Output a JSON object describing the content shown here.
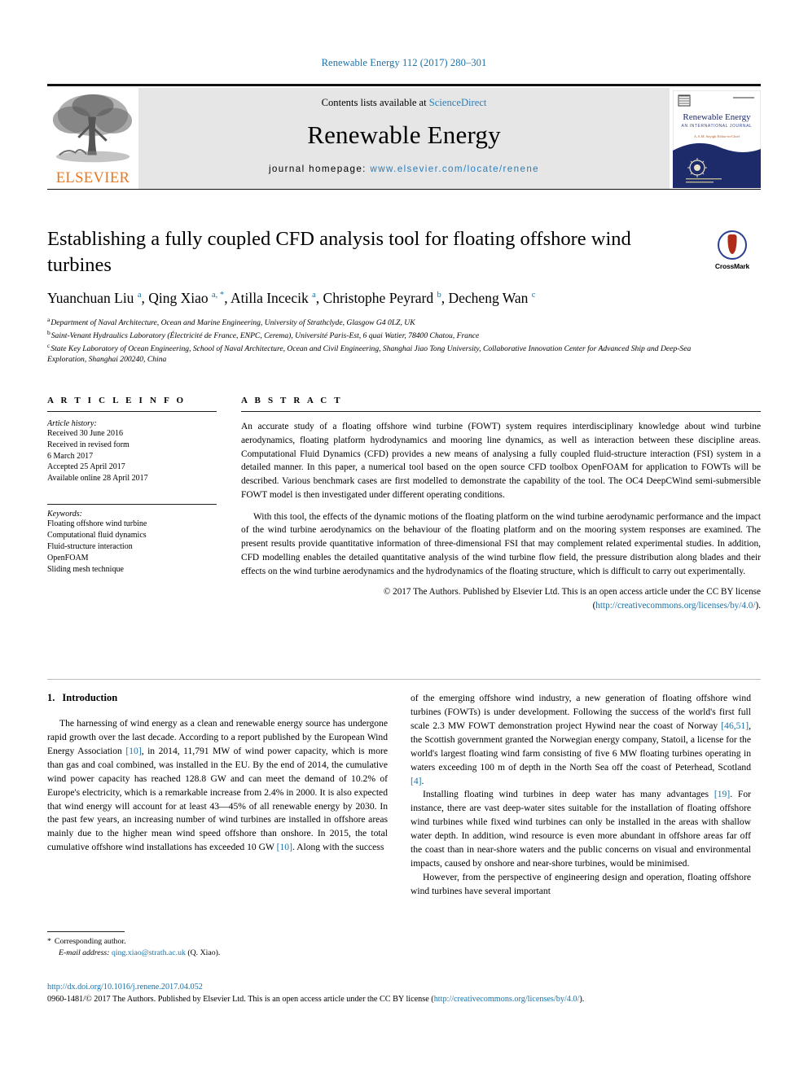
{
  "journal_ref": "Renewable Energy 112 (2017) 280–301",
  "masthead": {
    "contents_prefix": "Contents lists available at ",
    "sciencedirect": "ScienceDirect",
    "journal_title": "Renewable Energy",
    "homepage_label": "journal homepage: ",
    "homepage_url": "www.elsevier.com/locate/renene",
    "publisher_wordmark": "ELSEVIER",
    "cover": {
      "title": "Renewable Energy",
      "subtitle": "AN INTERNATIONAL JOURNAL",
      "editor_line": "A.A.M. Sayigh  Editor-in-Chief"
    }
  },
  "article": {
    "title": "Establishing a fully coupled CFD analysis tool for floating offshore wind turbines",
    "crossmark_label": "CrossMark",
    "authors": [
      {
        "name": "Yuanchuan Liu",
        "marks": "a"
      },
      {
        "name": "Qing Xiao",
        "marks": "a, *"
      },
      {
        "name": "Atilla Incecik",
        "marks": "a"
      },
      {
        "name": "Christophe Peyrard",
        "marks": "b"
      },
      {
        "name": "Decheng Wan",
        "marks": "c"
      }
    ],
    "affiliations": [
      {
        "mark": "a",
        "text": "Department of Naval Architecture, Ocean and Marine Engineering, University of Strathclyde, Glasgow G4 0LZ, UK"
      },
      {
        "mark": "b",
        "text": "Saint-Venant Hydraulics Laboratory (Électricité de France, ENPC, Cerema), Université Paris-Est, 6 quai Watier, 78400 Chatou, France"
      },
      {
        "mark": "c",
        "text": "State Key Laboratory of Ocean Engineering, School of Naval Architecture, Ocean and Civil Engineering, Shanghai Jiao Tong University, Collaborative Innovation Center for Advanced Ship and Deep-Sea Exploration, Shanghai 200240, China"
      }
    ]
  },
  "article_info": {
    "heading": "A R T I C L E   I N F O",
    "history_title": "Article history:",
    "history": [
      "Received 30 June 2016",
      "Received in revised form",
      "6 March 2017",
      "Accepted 25 April 2017",
      "Available online 28 April 2017"
    ],
    "keywords_title": "Keywords:",
    "keywords": [
      "Floating offshore wind turbine",
      "Computational fluid dynamics",
      "Fluid-structure interaction",
      "OpenFOAM",
      "Sliding mesh technique"
    ]
  },
  "abstract": {
    "heading": "A B S T R A C T",
    "paragraph1": "An accurate study of a floating offshore wind turbine (FOWT) system requires interdisciplinary knowledge about wind turbine aerodynamics, floating platform hydrodynamics and mooring line dynamics, as well as interaction between these discipline areas. Computational Fluid Dynamics (CFD) provides a new means of analysing a fully coupled fluid-structure interaction (FSI) system in a detailed manner. In this paper, a numerical tool based on the open source CFD toolbox OpenFOAM for application to FOWTs will be described. Various benchmark cases are first modelled to demonstrate the capability of the tool. The OC4 DeepCWind semi-submersible FOWT model is then investigated under different operating conditions.",
    "paragraph2": "With this tool, the effects of the dynamic motions of the floating platform on the wind turbine aerodynamic performance and the impact of the wind turbine aerodynamics on the behaviour of the floating platform and on the mooring system responses are examined. The present results provide quantitative information of three-dimensional FSI that may complement related experimental studies. In addition, CFD modelling enables the detailed quantitative analysis of the wind turbine flow field, the pressure distribution along blades and their effects on the wind turbine aerodynamics and the hydrodynamics of the floating structure, which is difficult to carry out experimentally.",
    "copyright": "© 2017 The Authors. Published by Elsevier Ltd. This is an open access article under the CC BY license",
    "license_open": "(",
    "license_url": "http://creativecommons.org/licenses/by/4.0/",
    "license_close": ")."
  },
  "body": {
    "section_number": "1.",
    "section_title": "Introduction",
    "left_paragraph_1a": "The harnessing of wind energy as a clean and renewable energy source has undergone rapid growth over the last decade. According to a report published by the European Wind Energy Association ",
    "left_cite_1": "[10]",
    "left_paragraph_1b": ", in 2014, 11,791 MW of wind power capacity, which is more than gas and coal combined, was installed in the EU. By the end of 2014, the cumulative wind power capacity has reached 128.8 GW and can meet the demand of 10.2% of Europe's electricity, which is a remarkable increase from 2.4% in 2000. It is also expected that wind energy will account for at least 43—45% of all renewable energy by 2030. In the past few years, an increasing number of wind turbines are installed in offshore areas mainly due to the higher mean wind speed offshore than onshore. In 2015, the total cumulative offshore wind installations has exceeded 10 GW ",
    "left_cite_2": "[10]",
    "left_paragraph_1c": ". Along with the success",
    "right_paragraph_1a": "of the emerging offshore wind industry, a new generation of floating offshore wind turbines (FOWTs) is under development. Following the success of the world's first full scale 2.3 MW FOWT demonstration project Hywind near the coast of Norway ",
    "right_cite_1": "[46,51]",
    "right_paragraph_1b": ", the Scottish government granted the Norwegian energy company, Statoil, a license for the world's largest floating wind farm consisting of five 6 MW floating turbines operating in waters exceeding 100 m of depth in the North Sea off the coast of Peterhead, Scotland ",
    "right_cite_2": "[4]",
    "right_paragraph_1c": ".",
    "right_paragraph_2a": "Installing floating wind turbines in deep water has many advantages ",
    "right_cite_3": "[19]",
    "right_paragraph_2b": ". For instance, there are vast deep-water sites suitable for the installation of floating offshore wind turbines while fixed wind turbines can only be installed in the areas with shallow water depth. In addition, wind resource is even more abundant in offshore areas far off the coast than in near-shore waters and the public concerns on visual and environmental impacts, caused by onshore and near-shore turbines, would be minimised.",
    "right_paragraph_3": "However, from the perspective of engineering design and operation, floating offshore wind turbines have several important"
  },
  "footnote": {
    "star": "*",
    "corresponding": "Corresponding author.",
    "email_label": "E-mail address:",
    "email": "qing.xiao@strath.ac.uk",
    "email_suffix": "(Q. Xiao)."
  },
  "bottom": {
    "doi": "http://dx.doi.org/10.1016/j.renene.2017.04.052",
    "issn_prefix": "0960-1481/© 2017 The Authors. Published by Elsevier Ltd. This is an open access article under the CC BY license (",
    "issn_license_url": "http://creativecommons.org/licenses/by/4.0/",
    "issn_suffix": ")."
  },
  "colors": {
    "link": "#1a72a8",
    "elsevier_orange": "#e87722",
    "cover_navy": "#1d2b6b",
    "masthead_grey": "#e6e6e6"
  }
}
